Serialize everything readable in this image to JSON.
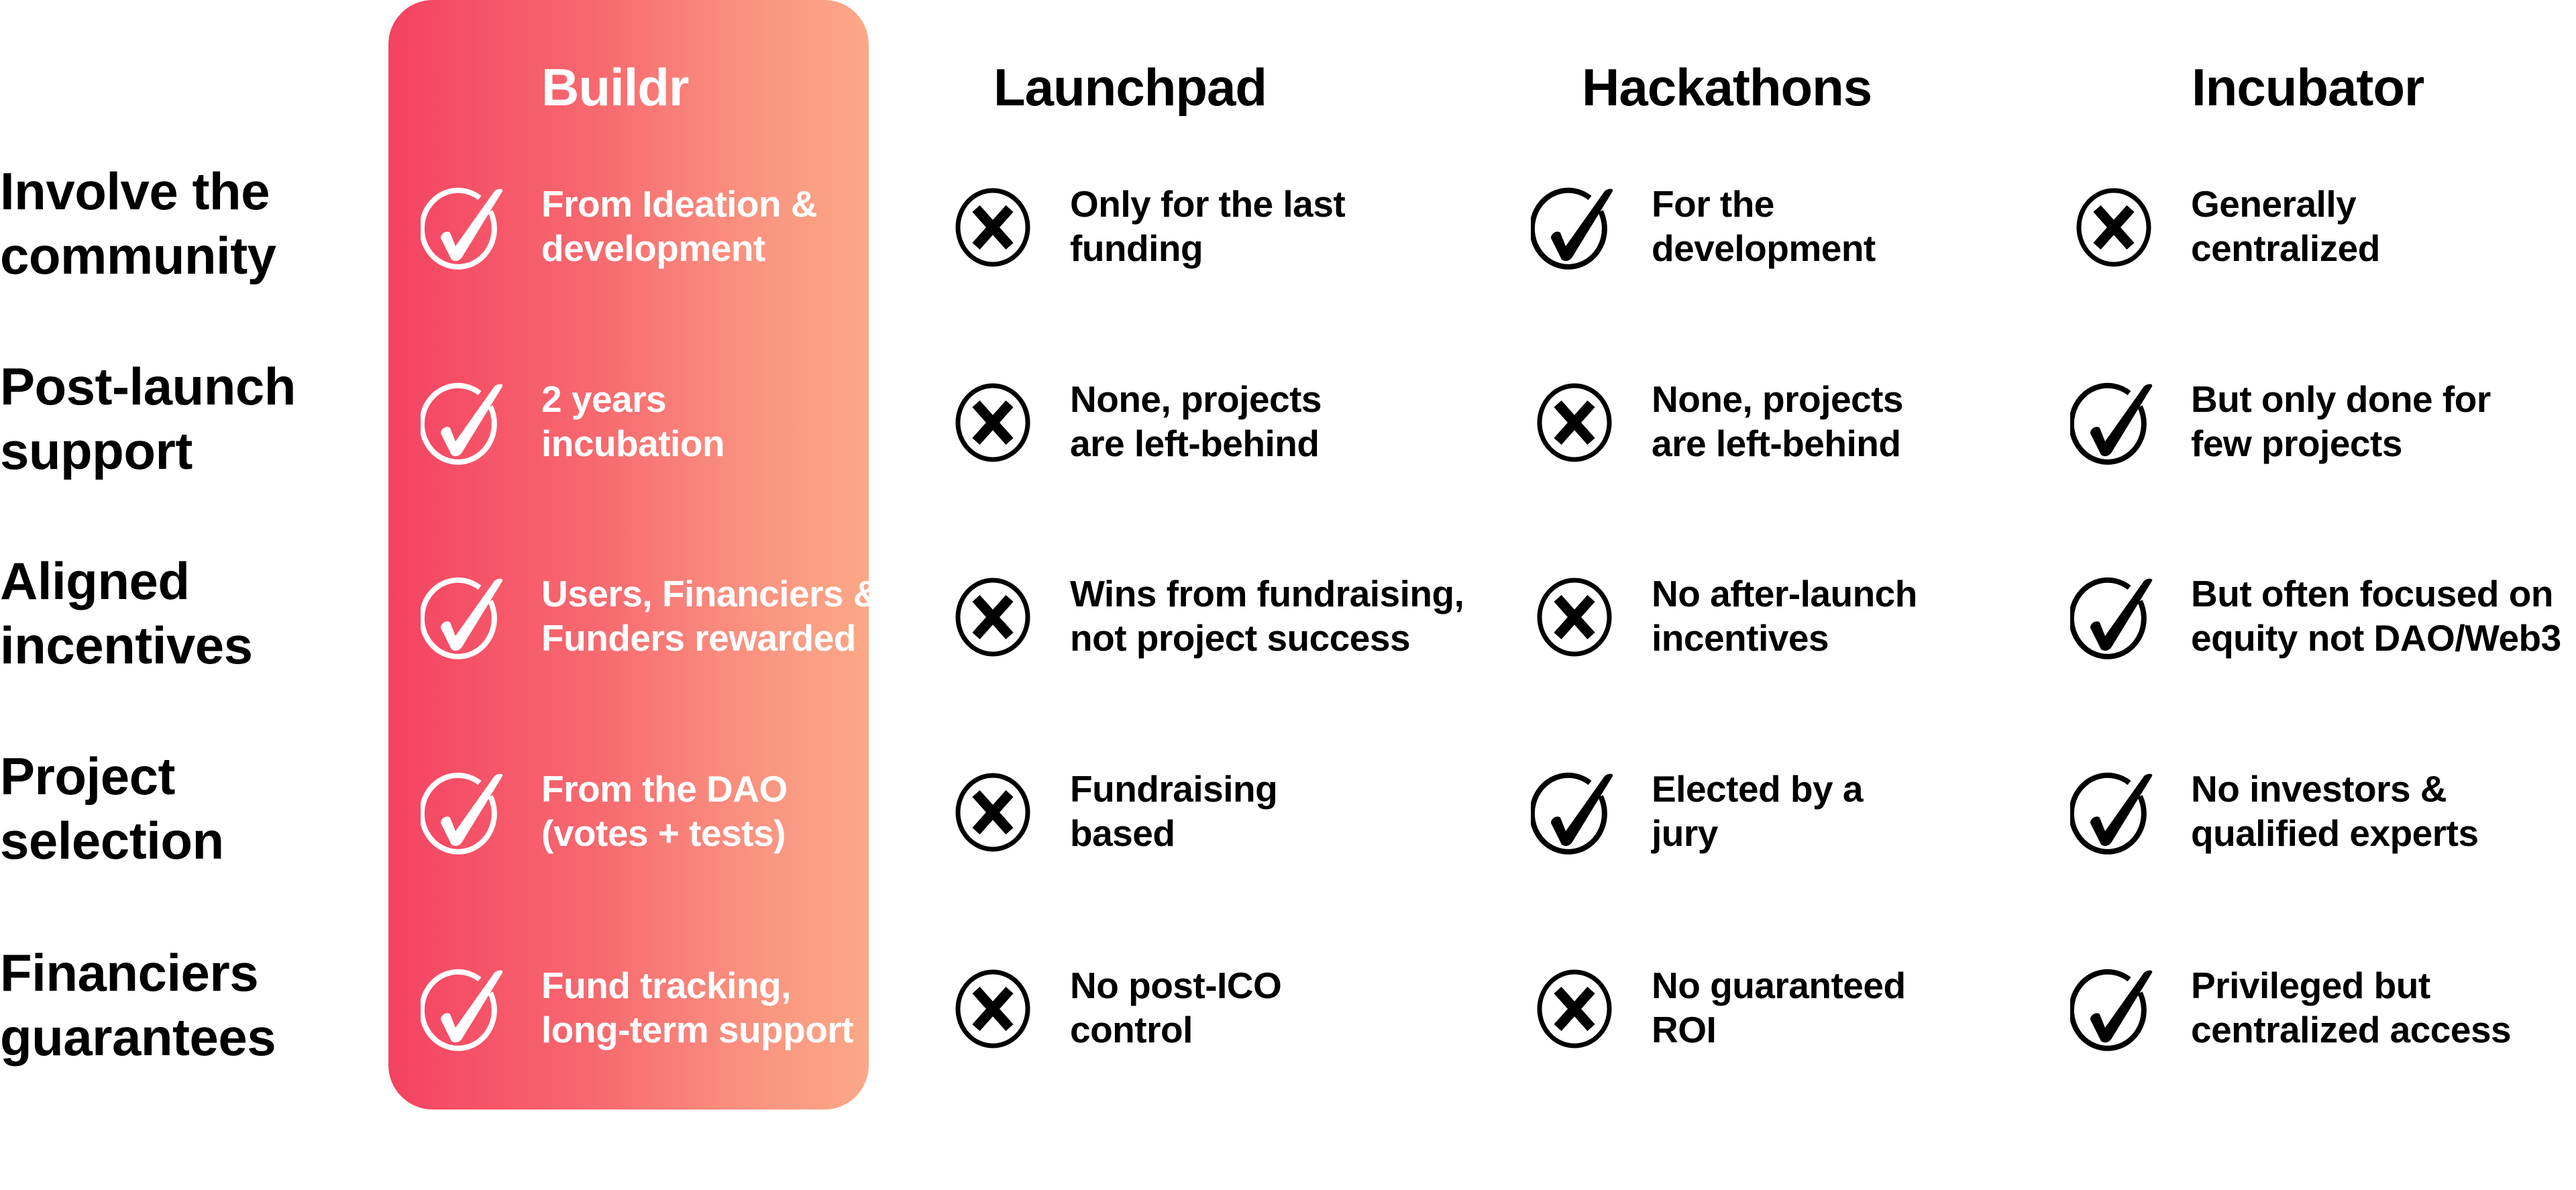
{
  "colors": {
    "accent_gradient_start": "#F44262",
    "accent_gradient_end": "#FBA887",
    "text": "#000000",
    "highlight_text": "#FFFFFF",
    "background": "#FFFFFF"
  },
  "columns": [
    {
      "label": "Buildr",
      "highlighted": true
    },
    {
      "label": "Launchpad",
      "highlighted": false
    },
    {
      "label": "Hackathons",
      "highlighted": false
    },
    {
      "label": "Incubator",
      "highlighted": false
    }
  ],
  "rows": [
    {
      "label": [
        "Involve the",
        "community"
      ],
      "cells": [
        {
          "icon": "check-circle-icon",
          "text": [
            "From Ideation &",
            "development"
          ]
        },
        {
          "icon": "x-circle-icon",
          "text": [
            "Only for the last",
            "funding"
          ]
        },
        {
          "icon": "check-circle-icon",
          "text": [
            "For the",
            "development"
          ]
        },
        {
          "icon": "x-circle-icon",
          "text": [
            "Generally",
            "centralized"
          ]
        }
      ]
    },
    {
      "label": [
        "Post-launch",
        "support"
      ],
      "cells": [
        {
          "icon": "check-circle-icon",
          "text": [
            "2 years",
            "incubation"
          ]
        },
        {
          "icon": "x-circle-icon",
          "text": [
            "None, projects",
            "are left-behind"
          ]
        },
        {
          "icon": "x-circle-icon",
          "text": [
            "None, projects",
            "are left-behind"
          ]
        },
        {
          "icon": "check-circle-icon",
          "text": [
            "But only done for",
            "few projects"
          ]
        }
      ]
    },
    {
      "label": [
        "Aligned",
        "incentives"
      ],
      "cells": [
        {
          "icon": "check-circle-icon",
          "text": [
            "Users, Financiers &",
            "Funders rewarded"
          ]
        },
        {
          "icon": "x-circle-icon",
          "text": [
            "Wins from fundraising,",
            "not project success"
          ]
        },
        {
          "icon": "x-circle-icon",
          "text": [
            "No after-launch",
            "incentives"
          ]
        },
        {
          "icon": "check-circle-icon",
          "text": [
            "But often focused on",
            "equity not DAO/Web3"
          ]
        }
      ]
    },
    {
      "label": [
        "Project",
        "selection"
      ],
      "cells": [
        {
          "icon": "check-circle-icon",
          "text": [
            "From the DAO",
            "(votes + tests)"
          ]
        },
        {
          "icon": "x-circle-icon",
          "text": [
            "Fundraising",
            "based"
          ]
        },
        {
          "icon": "check-circle-icon",
          "text": [
            "Elected by a",
            "jury"
          ]
        },
        {
          "icon": "check-circle-icon",
          "text": [
            "No investors &",
            "qualified experts"
          ]
        }
      ]
    },
    {
      "label": [
        "Financiers",
        "guarantees"
      ],
      "cells": [
        {
          "icon": "check-circle-icon",
          "text": [
            "Fund tracking,",
            "long-term support"
          ]
        },
        {
          "icon": "x-circle-icon",
          "text": [
            "No post-ICO",
            "control"
          ]
        },
        {
          "icon": "x-circle-icon",
          "text": [
            "No guaranteed",
            "ROI"
          ]
        },
        {
          "icon": "check-circle-icon",
          "text": [
            "Privileged but",
            "centralized access"
          ]
        }
      ]
    }
  ]
}
